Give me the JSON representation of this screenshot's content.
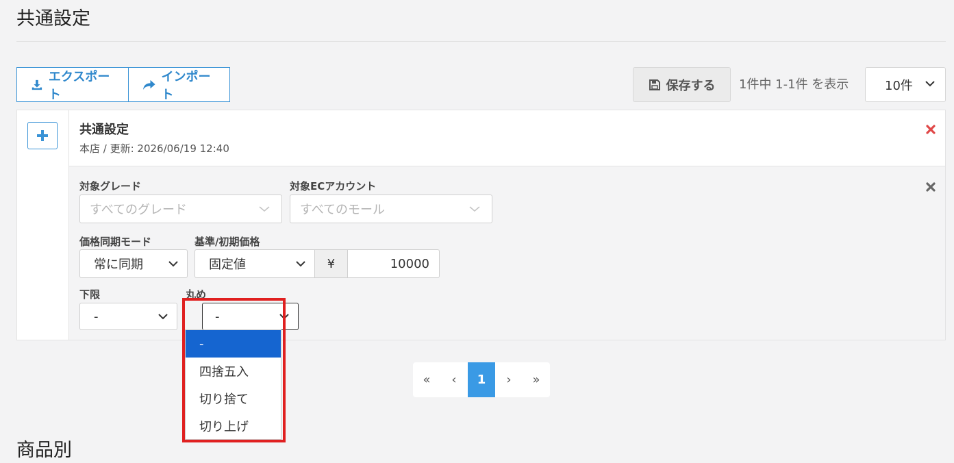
{
  "page": {
    "title": "共通設定",
    "next_section": "商品別"
  },
  "toolbar": {
    "export_label": "エクスポート",
    "import_label": "インポート",
    "save_label": "保存する",
    "count_text": "1件中 1-1件 を表示",
    "per_page": "10件"
  },
  "entry": {
    "title": "共通設定",
    "subtitle": "本店 / 更新: 2026/06/19 12:40",
    "fields": {
      "grade": {
        "label": "対象グレード",
        "placeholder": "すべてのグレード"
      },
      "ec_account": {
        "label": "対象ECアカウント",
        "placeholder": "すべてのモール"
      },
      "sync_mode": {
        "label": "価格同期モード",
        "value": "常に同期"
      },
      "base_price": {
        "label": "基準/初期価格",
        "mode": "固定値",
        "currency": "¥",
        "value": "10000"
      },
      "lower_limit": {
        "label": "下限",
        "value": "-"
      },
      "rounding": {
        "label": "丸め",
        "value": "-",
        "options": [
          "-",
          "四捨五入",
          "切り捨て",
          "切り上げ"
        ]
      }
    }
  },
  "pagination": {
    "first": "«",
    "prev": "‹",
    "current": "1",
    "next": "›",
    "last": "»"
  },
  "colors": {
    "accent": "#3a93d6",
    "danger": "#e04848",
    "selected": "#1565d0",
    "highlight": "#e02020"
  }
}
